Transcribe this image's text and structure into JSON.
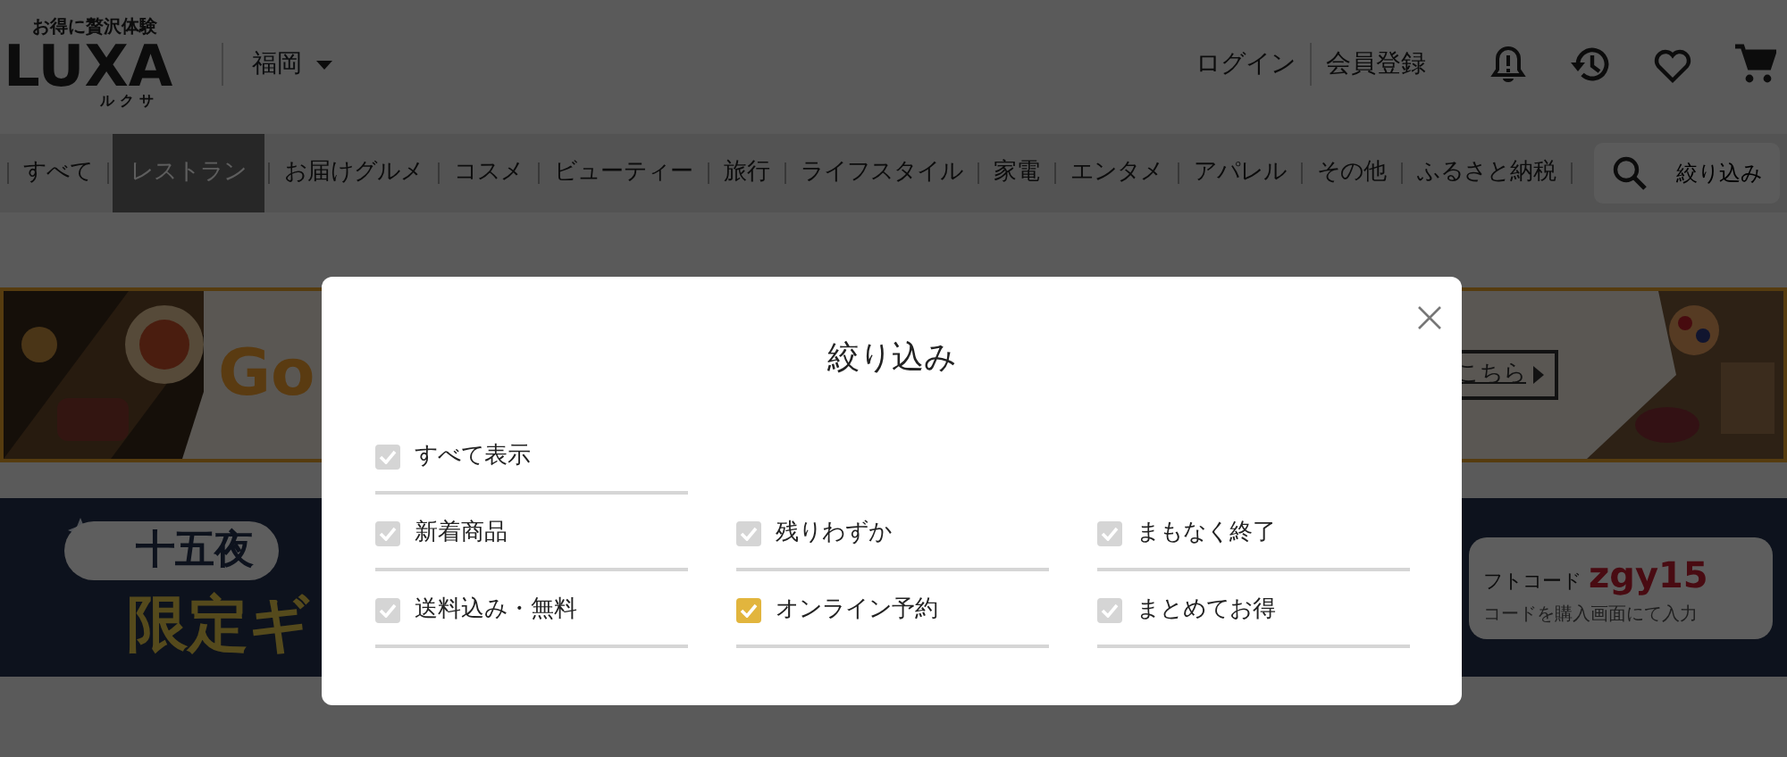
{
  "header": {
    "tagline": "お得に贅沢体験",
    "logo": "LUXA",
    "logo_reading": "ルクサ",
    "region": "福岡",
    "links": [
      "ログイン",
      "会員登録"
    ]
  },
  "categories": [
    {
      "label": "すべて",
      "selected": false
    },
    {
      "label": "レストラン",
      "selected": true
    },
    {
      "label": "お届けグルメ",
      "selected": false
    },
    {
      "label": "コスメ",
      "selected": false
    },
    {
      "label": "ビューティー",
      "selected": false
    },
    {
      "label": "旅行",
      "selected": false
    },
    {
      "label": "ライフスタイル",
      "selected": false
    },
    {
      "label": "家電",
      "selected": false
    },
    {
      "label": "エンタメ",
      "selected": false
    },
    {
      "label": "アパレル",
      "selected": false
    },
    {
      "label": "その他",
      "selected": false
    },
    {
      "label": "ふるさと納税",
      "selected": false
    }
  ],
  "filter_button": "絞り込み",
  "banners": [
    {
      "kind": "restaurant",
      "left_text": "Go",
      "button": "こちら"
    },
    {
      "kind": "gift",
      "pill": "十五夜",
      "left_text": "限定ギ",
      "code_label": "フトコード",
      "code": "zgy15",
      "note": "コードを購入画面にて入力"
    }
  ],
  "dialog": {
    "title": "絞り込み",
    "rows": [
      [
        {
          "label": "すべて表示",
          "checked": false
        }
      ],
      [
        {
          "label": "新着商品",
          "checked": false
        },
        {
          "label": "残りわずか",
          "checked": false
        },
        {
          "label": "まもなく終了",
          "checked": false
        }
      ],
      [
        {
          "label": "送料込み・無料",
          "checked": false
        },
        {
          "label": "オンライン予約",
          "checked": true
        },
        {
          "label": "まとめてお得",
          "checked": false
        }
      ]
    ]
  }
}
